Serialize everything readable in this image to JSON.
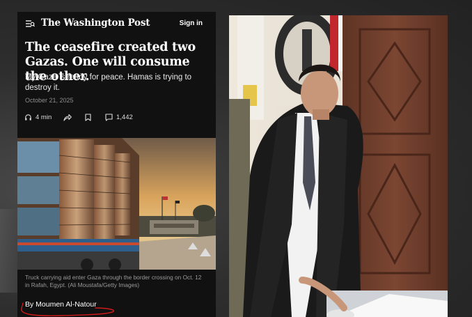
{
  "article": {
    "masthead": "The Washington Post",
    "sign_in": "Sign in",
    "headline": "The ceasefire created two Gazas. One will consume the other.",
    "dek": "My Gaza is ready for peace. Hamas is trying to destroy it.",
    "date": "October 21, 2025",
    "listen_time": "4 min",
    "comment_count": "1,442",
    "photo_caption": "Truck carrying aid enter Gaza through the border crossing on Oct. 12 in Rafah, Egypt. (Ali Moustafa/Getty Images)",
    "byline": "By Moumen Al-Natour"
  },
  "icons": [
    "menu-icon",
    "headphones-icon",
    "share-icon",
    "bookmark-icon",
    "comment-icon"
  ],
  "colors": {
    "panel_bg": "#111111",
    "annotation_red": "#d11a1a",
    "page_bg": "#2b2b2b"
  }
}
